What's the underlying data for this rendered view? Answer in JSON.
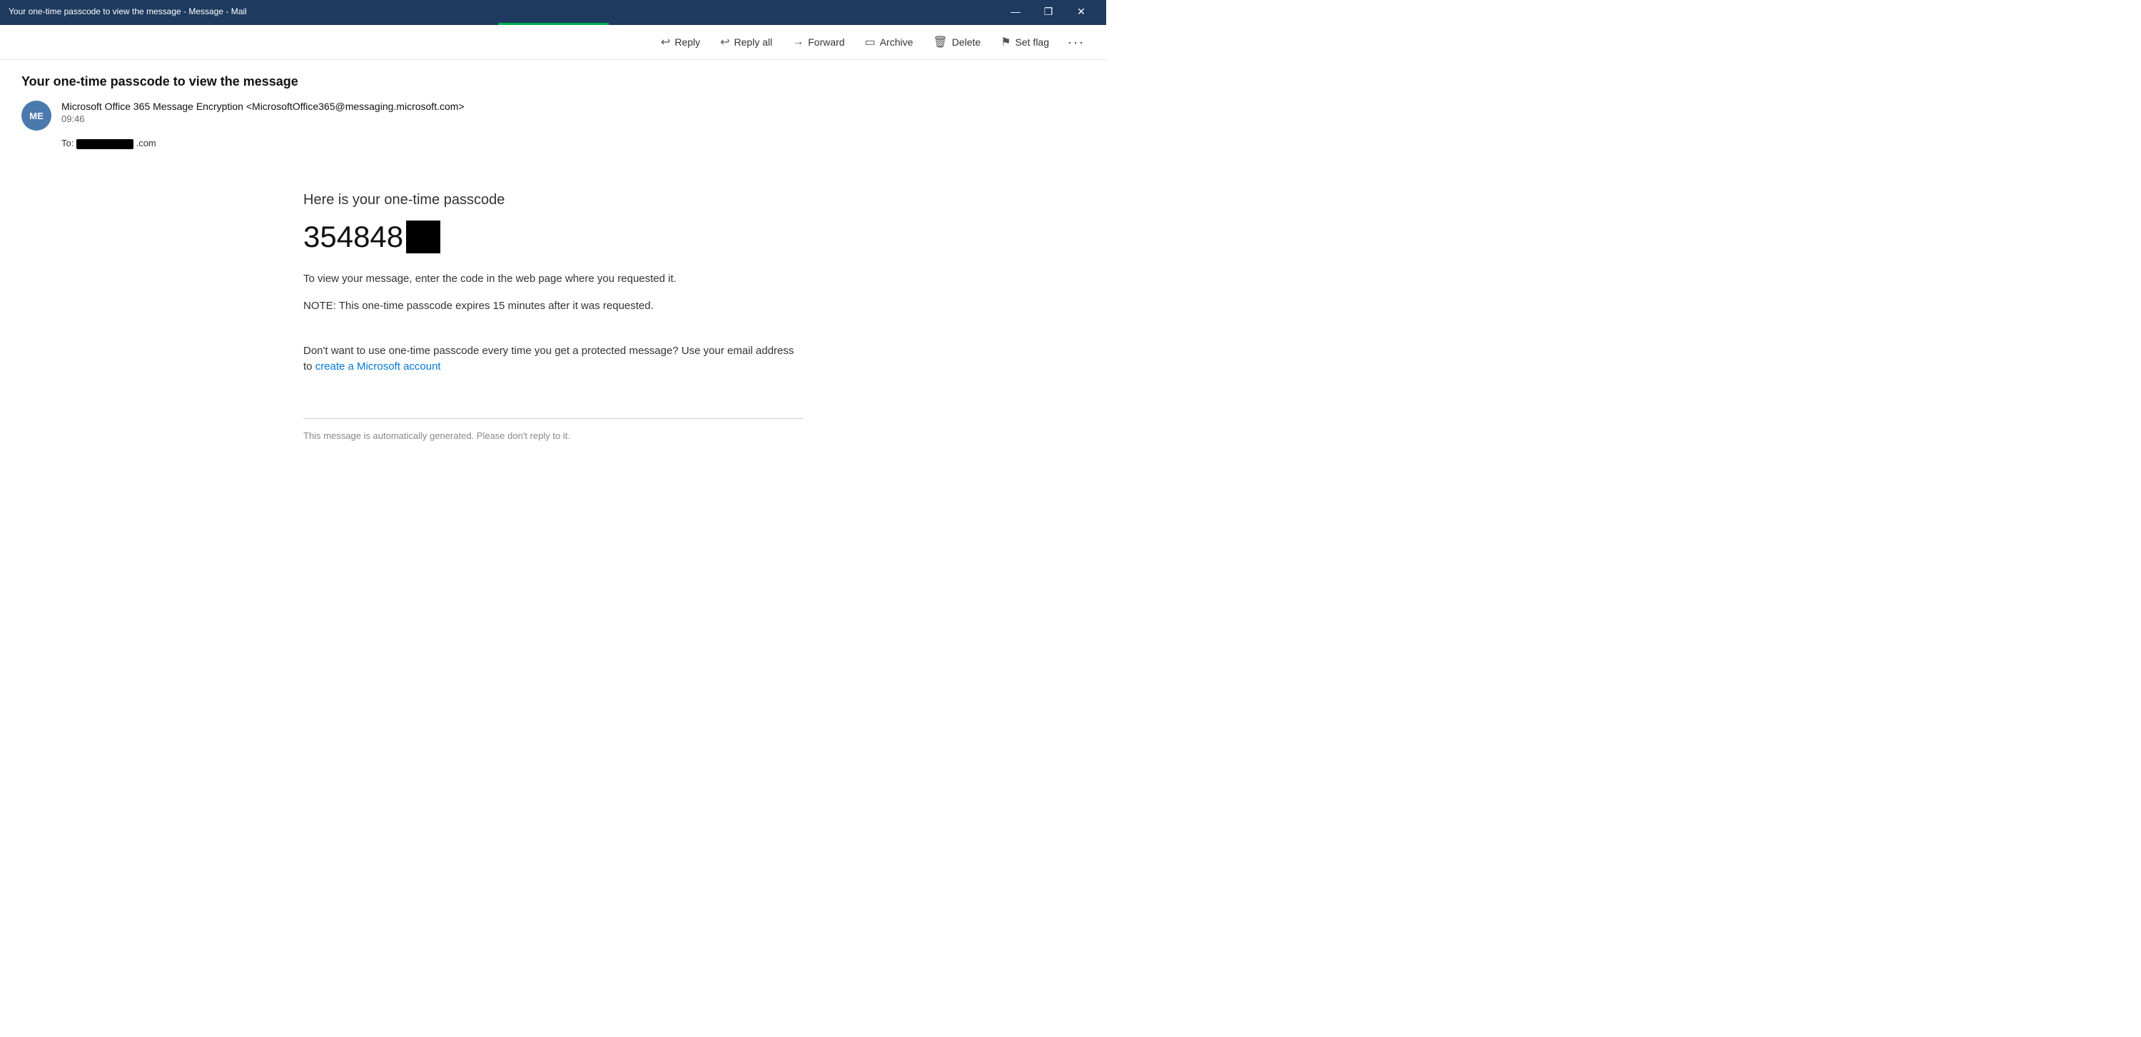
{
  "titleBar": {
    "title": "Your one-time passcode to view the message - Message - Mail",
    "controls": {
      "minimize": "—",
      "maximize": "❐",
      "close": "✕"
    }
  },
  "toolbar": {
    "reply_label": "Reply",
    "reply_all_label": "Reply all",
    "forward_label": "Forward",
    "archive_label": "Archive",
    "delete_label": "Delete",
    "set_flag_label": "Set flag",
    "more_label": "···"
  },
  "email": {
    "subject": "Your one-time passcode to view the message",
    "sender_initials": "ME",
    "sender_name": "Microsoft Office 365 Message Encryption <MicrosoftOffice365@messaging.microsoft.com>",
    "time": "09:46",
    "to_label": "To:",
    "to_domain": ".com",
    "body": {
      "heading": "Here is your one-time passcode",
      "passcode_visible": "354848",
      "instructions": "To view your message, enter the code in the web page where you requested it.",
      "note": "NOTE: This one-time passcode expires 15 minutes after it was requested.",
      "optional_text": "Don't want to use one-time passcode every time you get a protected message? Use your email address to",
      "link_text": "create a Microsoft account",
      "footer": "This message is automatically generated. Please don't reply to it."
    }
  }
}
